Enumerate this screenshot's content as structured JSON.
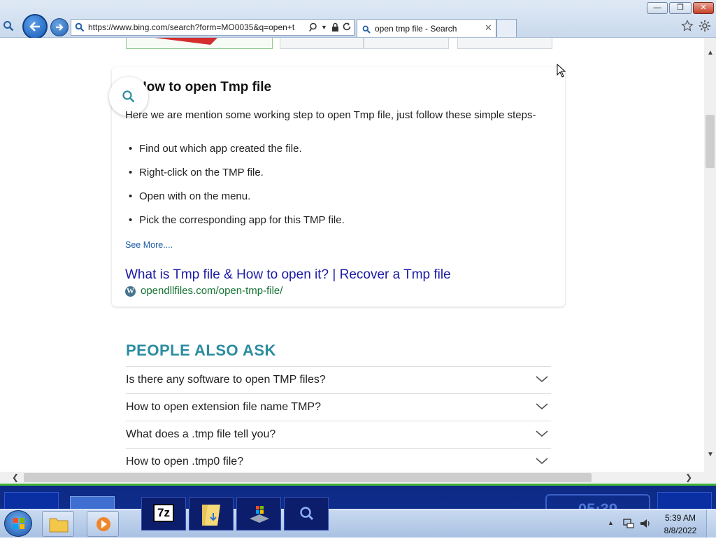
{
  "browser": {
    "url": "https://www.bing.com/search?form=MO0035&q=open+t",
    "tab_title": "open tmp file - Search"
  },
  "section": {
    "heading": "How to open Tmp file",
    "intro": "Here we are mention some working step to open Tmp file, just follow these simple steps-",
    "bullets": [
      "Find out which app created the file.",
      "Right-click on the TMP file.",
      "Open with on the menu.",
      "Pick the corresponding app for this TMP file."
    ],
    "see_more": "See More....",
    "result_title": "What is Tmp file & How to open it? | Recover a Tmp file",
    "result_url": "opendllfiles.com/open-tmp-file/"
  },
  "people_also_ask": {
    "heading": "PEOPLE ALSO ASK",
    "questions": [
      "Is there any software to open TMP files?",
      "How to open extension file name TMP?",
      "What does a .tmp file tell you?",
      "How to open .tmp0 file?"
    ]
  },
  "taskbar": {
    "time": "5:39 AM",
    "date": "8/8/2022",
    "app_7z": "7z",
    "overlay_clock": "05:39"
  },
  "colors": {
    "accent": "#2b8ca0",
    "link": "#1a1aa6",
    "url_green": "#137333",
    "taskbar_blue": "#0f2a8a"
  }
}
